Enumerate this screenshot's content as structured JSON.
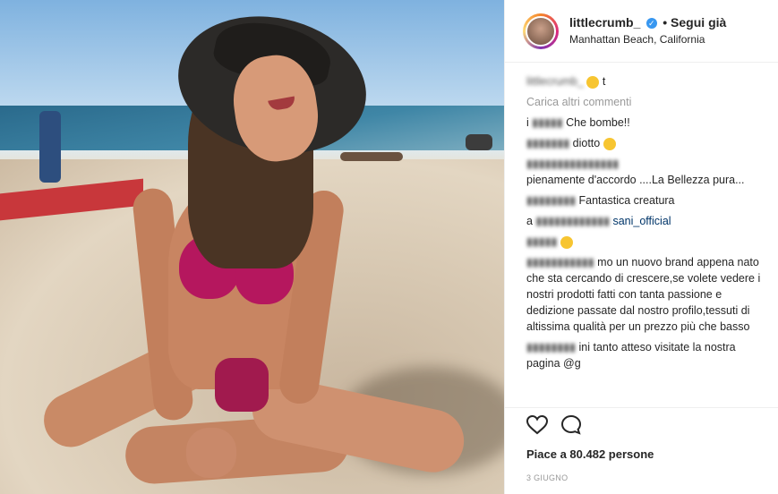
{
  "post": {
    "username": "littlecrumb_",
    "follow_label": "• Segui già",
    "location": "Manhattan Beach, California"
  },
  "comments": [
    {
      "user": "littlecrumb_",
      "text": "t"
    },
    {
      "user": "",
      "text": "Carica altri commenti"
    },
    {
      "user": "i",
      "text": "Che bombe!!"
    },
    {
      "user": "",
      "text": "diotto"
    },
    {
      "user": "",
      "text": "pienamente d'accordo ....La Bellezza pura..."
    },
    {
      "user": "",
      "text": "Fantastica creatura"
    },
    {
      "user": "a",
      "text": "sani_official"
    },
    {
      "user": "",
      "text": "mo un nuovo brand appena nato che sta cercando di crescere,se volete vedere i nostri prodotti fatti con tanta passione e dedizione passate dal nostro profilo,tessuti di altissima qualità per un prezzo più che basso"
    },
    {
      "user": "",
      "text": "ini tanto atteso visitate la nostra pagina @g"
    }
  ],
  "footer": {
    "likes": "Piace a 80.482 persone",
    "date": "3 GIUGNO"
  },
  "icons": [
    "heart-icon",
    "comment-icon",
    "verified-badge-icon"
  ],
  "colors": {
    "accent": "#3897f0",
    "bikini": "#b5175e",
    "border": "#efefef"
  }
}
